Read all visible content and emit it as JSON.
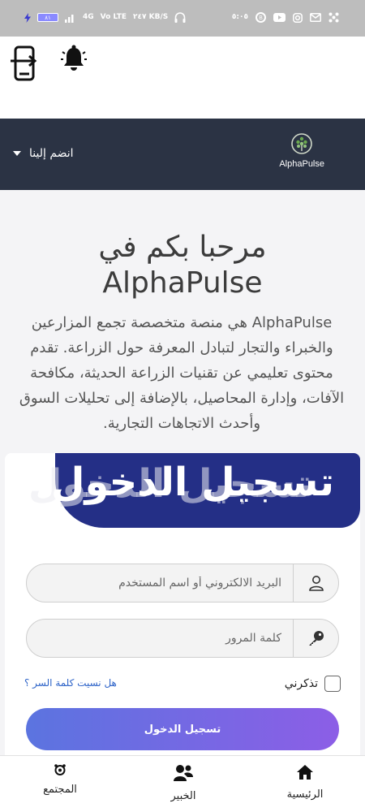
{
  "status_bar": {
    "battery": "۸۱",
    "signal_1": "4G",
    "data_1": "Vo LTE",
    "data_2": "۲٤٧ KB/S",
    "time": "٥:٠٥",
    "b_badge": "B"
  },
  "topbar": {
    "phone_icon": "phone-arrow-icon",
    "bell_icon": "bell-icon"
  },
  "navbar": {
    "join_label": "انضم إلينا",
    "brand_name": "AlphaPulse"
  },
  "hero": {
    "title_line1": "مرحبا بكم في",
    "title_line2": "AlphaPulse",
    "description": "AlphaPulse هي منصة متخصصة تجمع المزارعين والخبراء والتجار لتبادل المعرفة حول الزراعة. تقدم محتوى تعليمي عن تقنيات الزراعة الحديثة، مكافحة الآفات، وإدارة المحاصيل، بالإضافة إلى تحليلات السوق وأحدث الاتجاهات التجارية."
  },
  "login": {
    "title": "تسجيل الدخول",
    "email_placeholder": "البريد الالكتروني أو اسم المستخدم",
    "password_placeholder": "كلمة المرور",
    "remember_label": "تذكرني",
    "forgot_label": "هل نسيت كلمة السر ؟",
    "submit_label": "تسجيل الدخول"
  },
  "bottom_nav": {
    "home": "الرئيسية",
    "expert": "الخبير",
    "community": "المجتمع"
  },
  "colors": {
    "navbar_bg": "#2b3344",
    "banner_bg": "#242f86",
    "button_gradient_start": "#5b74e0",
    "button_gradient_end": "#8c5ee6",
    "link": "#2d63c8"
  }
}
